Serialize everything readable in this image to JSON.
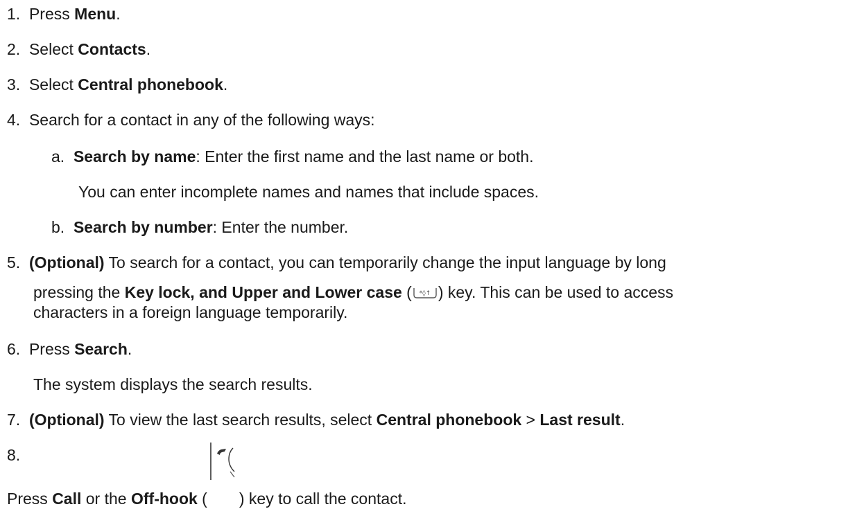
{
  "steps": {
    "s1": {
      "num": "1.",
      "t1": "Press ",
      "b1": "Menu",
      "t2": "."
    },
    "s2": {
      "num": "2.",
      "t1": "Select ",
      "b1": "Contacts",
      "t2": "."
    },
    "s3": {
      "num": "3.",
      "t1": "Select ",
      "b1": "Central phonebook",
      "t2": "."
    },
    "s4": {
      "num": "4.",
      "t1": "Search for a contact in any of the following ways:",
      "a": {
        "num": "a.",
        "b1": "Search by name",
        "t1": ": Enter the first name and the last name or both."
      },
      "a_note": "You can enter incomplete names and names that include spaces.",
      "b": {
        "num": "b.",
        "b1": "Search by number",
        "t1": ": Enter the number."
      }
    },
    "s5": {
      "num": "5.",
      "b0": "(Optional)",
      "t1": " To search for a contact, you can temporarily change the input language by long",
      "l2_t1": "pressing the ",
      "l2_b1": "Key lock, and Upper and Lower case",
      "l2_t2": " (",
      "l2_t3": ") key. This can be used to access",
      "l3": "characters in a foreign language temporarily."
    },
    "s6": {
      "num": "6.",
      "t1": "Press ",
      "b1": "Search",
      "t2": ".",
      "note": "The system displays the search results."
    },
    "s7": {
      "num": "7.",
      "b0": "(Optional)",
      "t1": " To view the last search results, select ",
      "b1": "Central phonebook",
      "t2": " > ",
      "b2": "Last result",
      "t3": "."
    },
    "s8": {
      "num": "8.",
      "t1": "Press ",
      "b1": "Call",
      "t2": " or the ",
      "b2": "Off-hook",
      "t3": " (",
      "t4": ") key to call the contact."
    }
  },
  "icons": {
    "keylock": "keylock-case-key-icon",
    "offhook": "offhook-key-icon"
  }
}
